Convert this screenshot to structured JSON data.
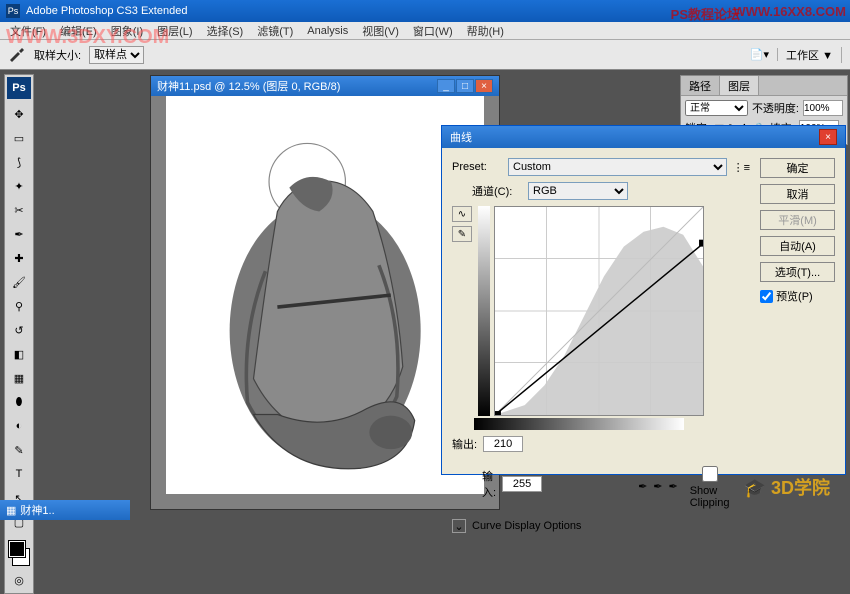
{
  "app": {
    "title": "Adobe Photoshop CS3 Extended",
    "ps_abbr": "Ps"
  },
  "menu": {
    "file": "文件(F)",
    "edit": "编辑(E)",
    "image": "图象(I)",
    "layer": "图层(L)",
    "select": "选择(S)",
    "filter": "滤镜(T)",
    "analysis": "Analysis",
    "view": "视图(V)",
    "window": "窗口(W)",
    "help": "帮助(H)"
  },
  "options": {
    "sample_label": "取样大小:",
    "sample_value": "取样点",
    "workspace_btn": "工作区 ▼"
  },
  "document": {
    "title": "财神11.psd @ 12.5% (图层 0, RGB/8)"
  },
  "panel_layers": {
    "tab1": "路径",
    "tab2": "图层",
    "blend": "正常",
    "opacity_lbl": "不透明度:",
    "opacity": "100%",
    "lock_lbl": "锁定:",
    "fill_lbl": "填充:",
    "fill": "100%"
  },
  "curves": {
    "title": "曲线",
    "preset_lbl": "Preset:",
    "preset": "Custom",
    "channel_lbl": "通道(C):",
    "channel": "RGB",
    "output_lbl": "输出:",
    "output": "210",
    "input_lbl": "输入:",
    "input": "255",
    "show_clip": "Show Clipping",
    "cdo": "Curve Display Options",
    "ok": "确定",
    "cancel": "取消",
    "smooth": "平滑(M)",
    "auto": "自动(A)",
    "options": "选项(T)...",
    "preview": "预览(P)"
  },
  "taskbar": {
    "doc": "财神1.."
  },
  "watermarks": {
    "w1": "WWW.3DXY.COM",
    "w2": "PS教程论坛",
    "w3": "WWW.16XX8.COM",
    "w4": "🎓 3D学院"
  },
  "chart_data": {
    "type": "line",
    "title": "Curves adjustment",
    "xlabel": "Input",
    "ylabel": "Output",
    "xlim": [
      0,
      255
    ],
    "ylim": [
      0,
      255
    ],
    "points": [
      {
        "x": 0,
        "y": 0
      },
      {
        "x": 255,
        "y": 210
      }
    ],
    "histogram_note": "grayscale histogram backdrop peaking mid-to-high tones"
  }
}
